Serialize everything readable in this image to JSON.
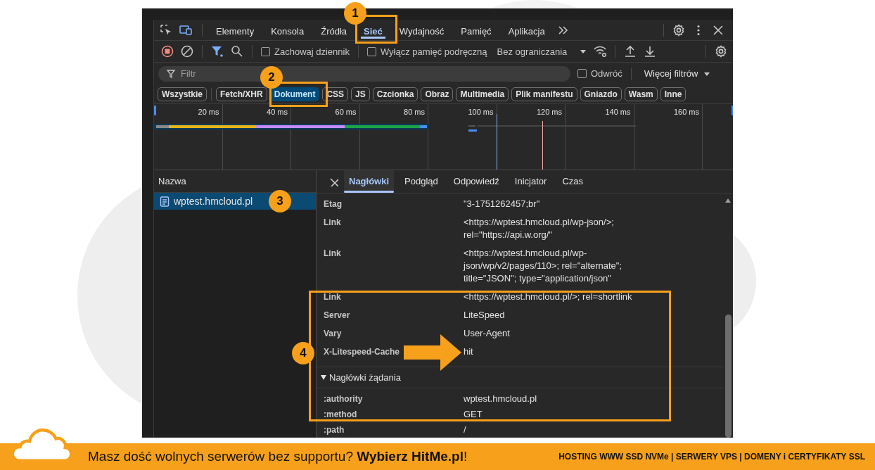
{
  "toolbar": {
    "tabs": [
      {
        "label": "Elementy",
        "selected": false
      },
      {
        "label": "Konsola",
        "selected": false
      },
      {
        "label": "Źródła",
        "selected": false
      },
      {
        "label": "Sieć",
        "selected": true
      },
      {
        "label": "Wydajność",
        "selected": false
      },
      {
        "label": "Pamięć",
        "selected": false
      },
      {
        "label": "Aplikacja",
        "selected": false
      }
    ]
  },
  "network_toolbar": {
    "checkboxes": [
      {
        "label": "Zachowaj dziennik",
        "checked": false
      },
      {
        "label": "Wyłącz pamięć podręczną",
        "checked": false
      }
    ],
    "throttling": "Bez ograniczania"
  },
  "filter_bar": {
    "placeholder": "Filtr",
    "invert": {
      "label": "Odwróć",
      "checked": false
    },
    "more_filters": "Więcej filtrów"
  },
  "type_filters": [
    {
      "label": "Wszystkie",
      "selected": false
    },
    {
      "label": "Fetch/XHR",
      "selected": false
    },
    {
      "label": "Dokument",
      "selected": true
    },
    {
      "label": "CSS",
      "selected": false
    },
    {
      "label": "JS",
      "selected": false
    },
    {
      "label": "Czcionka",
      "selected": false
    },
    {
      "label": "Obraz",
      "selected": false
    },
    {
      "label": "Multimedia",
      "selected": false
    },
    {
      "label": "Plik manifestu",
      "selected": false
    },
    {
      "label": "Gniazdo",
      "selected": false
    },
    {
      "label": "Wasm",
      "selected": false
    },
    {
      "label": "Inne",
      "selected": false
    }
  ],
  "timeline": {
    "ticks": [
      "20 ms",
      "40 ms",
      "60 ms",
      "80 ms",
      "100 ms",
      "120 ms",
      "140 ms",
      "160 ms"
    ]
  },
  "requests": {
    "column": "Nazwa",
    "rows": [
      {
        "name": "wptest.hmcloud.pl",
        "selected": true
      }
    ]
  },
  "details": {
    "tabs": [
      {
        "label": "Nagłówki",
        "selected": true
      },
      {
        "label": "Podgląd",
        "selected": false
      },
      {
        "label": "Odpowiedź",
        "selected": false
      },
      {
        "label": "Inicjator",
        "selected": false
      },
      {
        "label": "Czas",
        "selected": false
      }
    ],
    "response_headers": [
      {
        "name": "Etag",
        "value": "\"3-1751262457;br\""
      },
      {
        "name": "Link",
        "value": "<https://wptest.hmcloud.pl/wp-json/>; rel=\"https://api.w.org/\""
      },
      {
        "name": "Link",
        "value": "<https://wptest.hmcloud.pl/wp-json/wp/v2/pages/110>; rel=\"alternate\"; title=\"JSON\"; type=\"application/json\""
      },
      {
        "name": "Link",
        "value": "<https://wptest.hmcloud.pl/>; rel=shortlink"
      },
      {
        "name": "Server",
        "value": "LiteSpeed"
      },
      {
        "name": "Vary",
        "value": "User-Agent"
      },
      {
        "name": "X-Litespeed-Cache",
        "value": "hit"
      }
    ],
    "request_section": {
      "title": "Nagłówki żądania",
      "expanded": true
    },
    "request_headers": [
      {
        "name": ":authority",
        "value": "wptest.hmcloud.pl"
      },
      {
        "name": ":method",
        "value": "GET"
      },
      {
        "name": ":path",
        "value": "/"
      }
    ]
  },
  "annotations": [
    {
      "number": "1"
    },
    {
      "number": "2"
    },
    {
      "number": "3"
    },
    {
      "number": "4"
    }
  ],
  "banner": {
    "slogan": "Masz dość wolnych serwerów bez supportu? **Wybierz HitMe.pl**!",
    "services": "HOSTING WWW SSD NVMe | SERWERY VPS | DOMENY i CERTYFIKATY SSL"
  }
}
